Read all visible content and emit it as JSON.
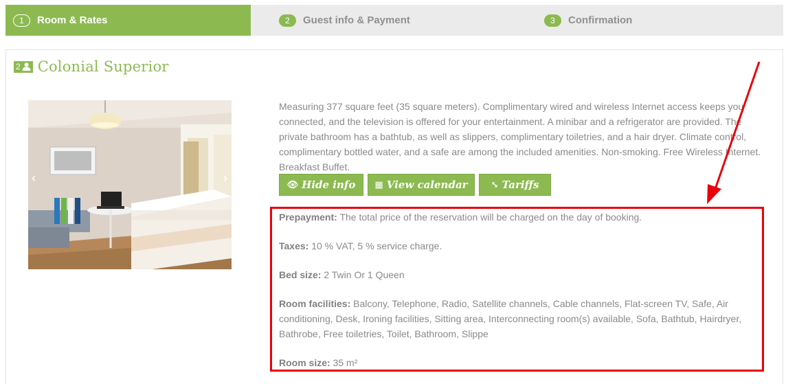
{
  "steps": [
    {
      "num": "1",
      "label": "Room & Rates",
      "active": true
    },
    {
      "num": "2",
      "label": "Guest info & Payment",
      "active": false
    },
    {
      "num": "3",
      "label": "Confirmation",
      "active": false
    }
  ],
  "room": {
    "occupancy": "2",
    "occupancy_icon": "person-icon",
    "title": "Colonial Superior",
    "description": "Measuring 377 square feet (35 square meters). Complimentary wired and wireless Internet access keeps you connected, and the television is offered for your entertainment. A minibar and a refrigerator are provided. The private bathroom has a bathtub, as well as slippers, complimentary toiletries, and a hair dryer. Climate control, complimentary bottled water, and a safe are among the included amenities. Non-smoking. Free Wireless Internet. Breakfast Buffet.",
    "gallery": {
      "prev": "‹",
      "next": "›"
    }
  },
  "buttons": {
    "hide_info": "Hide info",
    "view_calendar": "View calendar",
    "tariffs": "Tariffs"
  },
  "details": {
    "prepayment_label": "Prepayment:",
    "prepayment_value": "The total price of the reservation will be charged on the day of booking.",
    "taxes_label": "Taxes:",
    "taxes_value": "10 % VAT, 5 % service charge.",
    "bed_label": "Bed size:",
    "bed_value": "2 Twin Or 1 Queen",
    "facilities_label": "Room facilities:",
    "facilities_value": "Balcony, Telephone, Radio, Satellite channels, Cable channels, Flat-screen TV, Safe, Air conditioning, Desk, Ironing facilities, Sitting area, Interconnecting room(s) available, Sofa, Bathtub, Hairdryer, Bathrobe, Free toiletries, Toilet, Bathroom, Slippe",
    "size_label": "Room size:",
    "size_value": "35 m²"
  },
  "colors": {
    "accent": "#8cba51",
    "annotation": "#e8000b",
    "steps_bg": "#ebebeb"
  }
}
